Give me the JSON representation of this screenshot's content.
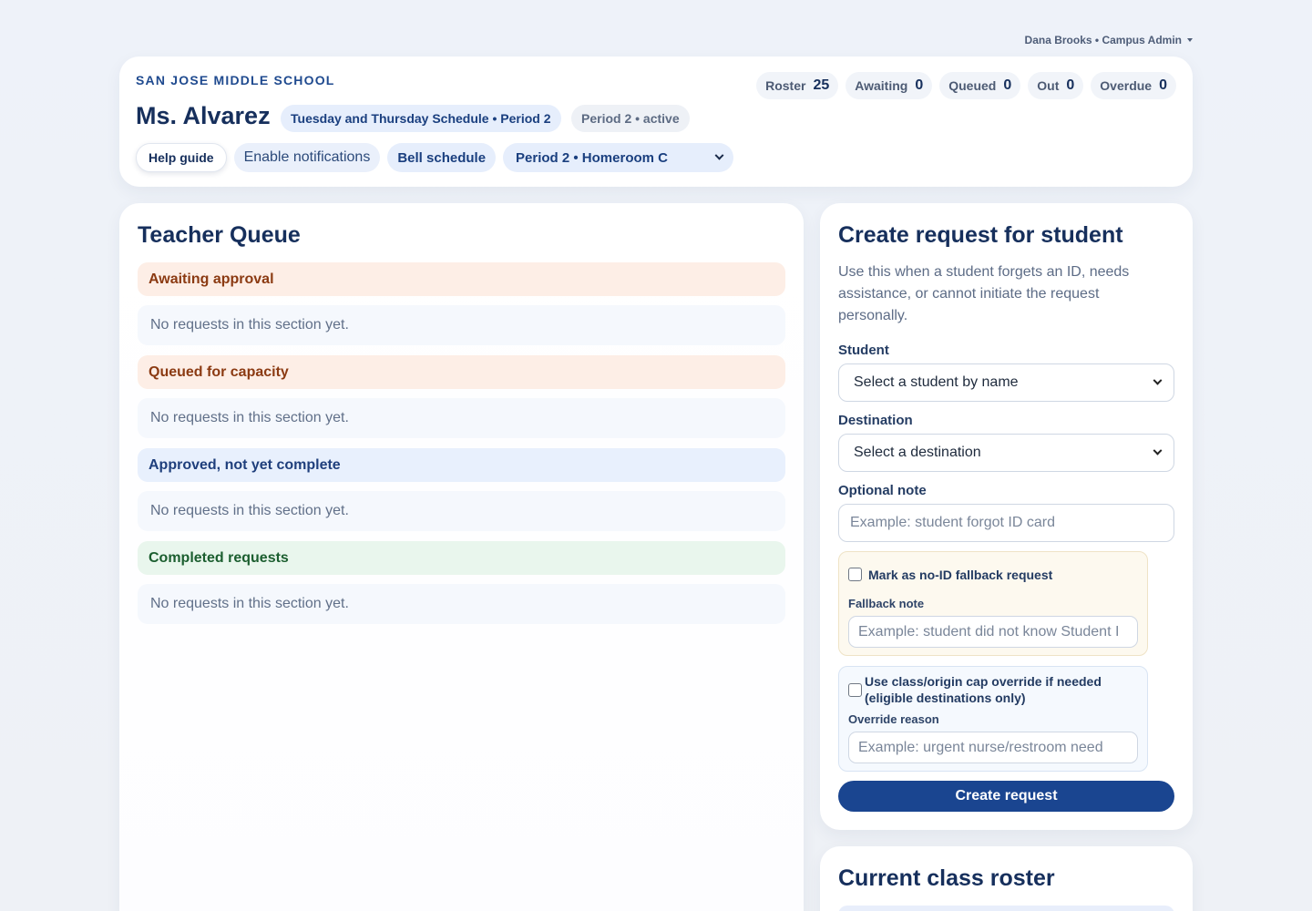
{
  "user_menu": {
    "label": "Dana Brooks • Campus Admin"
  },
  "header": {
    "school_name": "SAN JOSE MIDDLE SCHOOL",
    "teacher_name": "Ms. Alvarez",
    "schedule_badge": "Tuesday and Thursday Schedule • Period 2",
    "period_status": "Period 2 • active",
    "stats": [
      {
        "label": "Roster",
        "value": "25"
      },
      {
        "label": "Awaiting",
        "value": "0"
      },
      {
        "label": "Queued",
        "value": "0"
      },
      {
        "label": "Out",
        "value": "0"
      },
      {
        "label": "Overdue",
        "value": "0"
      }
    ],
    "toolbar": {
      "help": "Help guide",
      "notifications": "Enable notifications",
      "bell": "Bell schedule",
      "period_select": "Period 2 • Homeroom C"
    }
  },
  "queue": {
    "title": "Teacher Queue",
    "sections": [
      {
        "title": "Awaiting approval",
        "empty": "No requests in this section yet."
      },
      {
        "title": "Queued for capacity",
        "empty": "No requests in this section yet."
      },
      {
        "title": "Approved, not yet complete",
        "empty": "No requests in this section yet."
      },
      {
        "title": "Completed requests",
        "empty": "No requests in this section yet."
      }
    ]
  },
  "create_request": {
    "title": "Create request for student",
    "description": "Use this when a student forgets an ID, needs assistance, or cannot initiate the request personally.",
    "student_label": "Student",
    "student_select": "Select a student by name",
    "destination_label": "Destination",
    "destination_select": "Select a destination",
    "note_label": "Optional note",
    "note_placeholder": "Example: student forgot ID card",
    "fallback_checkbox": "Mark as no-ID fallback request",
    "fallback_note_label": "Fallback note",
    "fallback_note_placeholder": "Example: student did not know Student I",
    "override_checkbox": "Use class/origin cap override if needed (eligible destinations only)",
    "override_reason_label": "Override reason",
    "override_reason_placeholder": "Example: urgent nurse/restroom need",
    "submit": "Create request"
  },
  "roster": {
    "title": "Current class roster"
  }
}
